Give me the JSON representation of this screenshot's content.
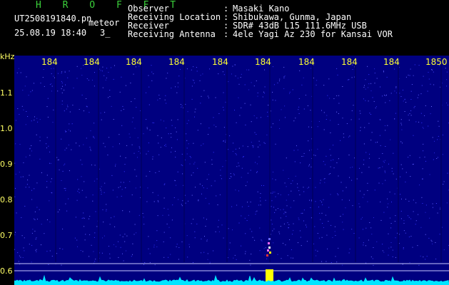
{
  "header": {
    "brand": "H R O F F T",
    "filename": "UT2508191840.pn",
    "meteor_label": "meteor",
    "datetime": "25.08.19 18:40",
    "count_text": "3_",
    "fields": [
      {
        "key": "Observer",
        "sep": ":",
        "value": "Masaki Kano"
      },
      {
        "key": "Receiving Location",
        "sep": ":",
        "value": "Shibukawa, Gunma, Japan"
      },
      {
        "key": "Receiver",
        "sep": ":",
        "value": "SDR# 43dB L15 111.6MHz USB"
      },
      {
        "key": "Receiving Antenna",
        "sep": ":",
        "value": "4ele Yagi Az 230 for Kansai VOR"
      }
    ]
  },
  "spectrogram": {
    "y_unit": "kHz",
    "y_ticks": [
      "1.1",
      "1.0",
      "0.9",
      "0.8",
      "0.7",
      "0.6"
    ],
    "x_ticks": [
      "184",
      "184",
      "184",
      "184",
      "184",
      "184",
      "184",
      "184",
      "184",
      "1850"
    ],
    "colors": {
      "background": "#000080",
      "noise": "#3a3aff",
      "tick_labels": "#ffff33",
      "spectrum": "#00e5ff",
      "meteor_peak": "#ffff00"
    }
  }
}
